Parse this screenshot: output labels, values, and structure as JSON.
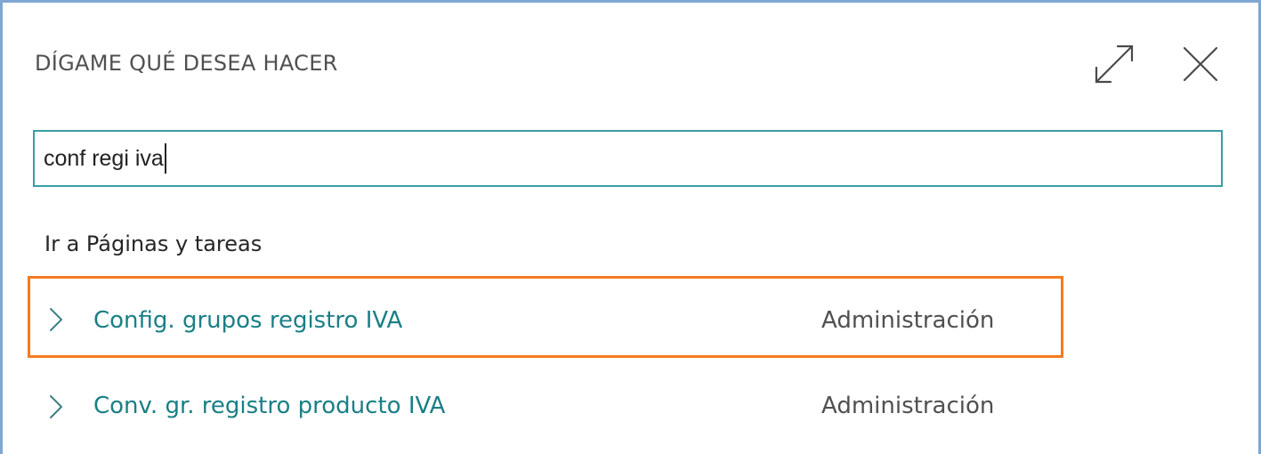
{
  "dialog": {
    "title": "DÍGAME QUÉ DESEA HACER",
    "expand_icon": "expand-diagonal-arrows-icon",
    "close_icon": "close-x-icon"
  },
  "search": {
    "value": "conf regi iva",
    "placeholder": ""
  },
  "section": {
    "heading": "Ir a Páginas y tareas"
  },
  "results": [
    {
      "label": "Config. grupos registro IVA",
      "category": "Administración",
      "icon": "chevron-right-icon",
      "highlighted": true
    },
    {
      "label": "Conv. gr. registro producto IVA",
      "category": "Administración",
      "icon": "chevron-right-icon",
      "highlighted": false
    }
  ],
  "colors": {
    "accent_teal": "#1a7f86",
    "search_border": "#3a9ea4",
    "highlight_orange": "#f47b20",
    "dialog_border": "#7fa7d3"
  }
}
